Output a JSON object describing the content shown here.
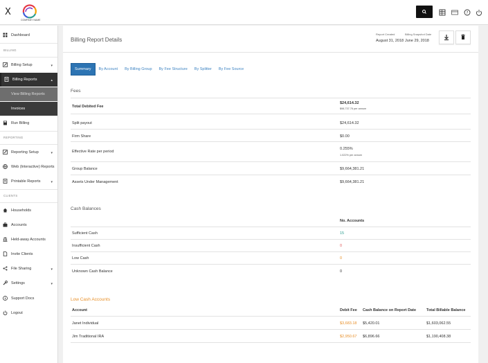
{
  "topbar": {
    "close_label": "X",
    "company_name": "COMPANY NAME"
  },
  "sidebar": {
    "dashboard": "Dashboard",
    "section_billing": "BILLING",
    "billing_setup": "Billing Setup",
    "billing_reports": "Billing Reports",
    "view_billing_reports": "View Billing Reports",
    "invoices": "Invoices",
    "run_billing": "Run Billing",
    "section_reporting": "REPORTING",
    "reporting_setup": "Reporting Setup",
    "web_reports": "Web (Interactive) Reports",
    "printable_reports": "Printable Reports",
    "section_clients": "CLIENTS",
    "households": "Households",
    "accounts": "Accounts",
    "held_away": "Held-away Accounts",
    "invite_clients": "Invite Clients",
    "file_sharing": "File Sharing",
    "settings": "Settings",
    "support_docs": "Support Docs",
    "logout": "Logout"
  },
  "header": {
    "title": "Billing Report Details",
    "report_created_label": "Report Created",
    "report_created_value": "August 31, 2018",
    "snapshot_label": "Billing Snapshot Date",
    "snapshot_value": "June 29, 2018"
  },
  "tabs": [
    "Summary",
    "By Account",
    "By Billing Group",
    "By Fee Structure",
    "By Splitter",
    "By Fee Source"
  ],
  "fees": {
    "title": "Fees",
    "rows": [
      {
        "label": "Total Debited Fee",
        "value": "$24,614.32",
        "sub": "$98,737.76 per annum"
      },
      {
        "label": "Split payout",
        "value": "$24,614.32",
        "sub": ""
      },
      {
        "label": "Firm Share",
        "value": "$0.00",
        "sub": ""
      },
      {
        "label": "Effective Rate per period",
        "value": "0.255%",
        "sub": "1.022% per annum"
      },
      {
        "label": "Group Balance",
        "value": "$9,664,381.21",
        "sub": ""
      },
      {
        "label": "Assets Under Management",
        "value": "$9,664,381.21",
        "sub": ""
      }
    ]
  },
  "cash": {
    "title": "Cash Balances",
    "col_header": "No. Accounts",
    "rows": [
      {
        "label": "Sufficient Cash",
        "value": "15"
      },
      {
        "label": "Insufficient Cash",
        "value": "0"
      },
      {
        "label": "Low Cash",
        "value": "0"
      },
      {
        "label": "Unknown Cash Balance",
        "value": "0"
      }
    ]
  },
  "low_cash": {
    "title": "Low Cash Accounts",
    "headers": [
      "Account",
      "Debit Fee",
      "Cash Balance on Report Date",
      "Total Billable Balance"
    ],
    "rows": [
      [
        "Janet Individual",
        "$3,683.18",
        "$5,420.01",
        "$1,603,062.55"
      ],
      [
        "Jim Traditional IRA",
        "$2,950.67",
        "$6,896.66",
        "$1,190,408.38"
      ]
    ]
  },
  "colors": {
    "accent": "#2d74b3",
    "tab_link": "#3d83c2",
    "orange": "#e8902a",
    "green": "#2a9d8f",
    "red": "#e05a5a"
  }
}
